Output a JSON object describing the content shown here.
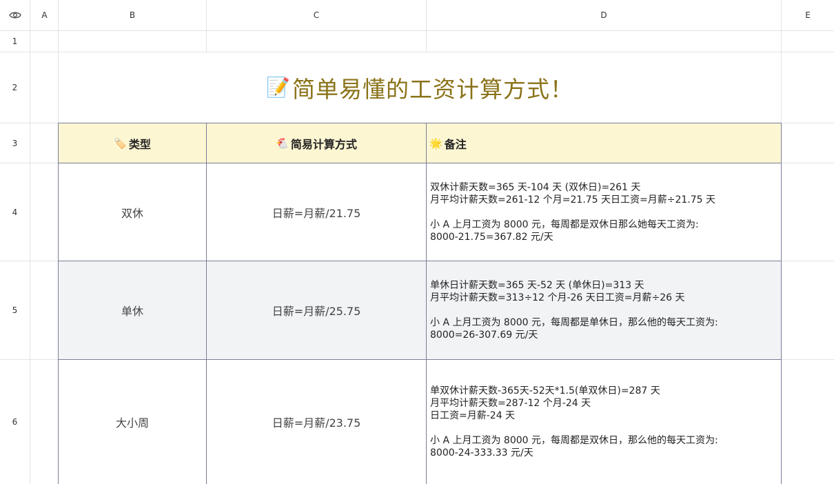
{
  "columns": [
    "A",
    "B",
    "C",
    "D",
    "E"
  ],
  "rows": [
    "1",
    "2",
    "3",
    "4",
    "5",
    "6"
  ],
  "corner_icon": "eye-icon",
  "title": {
    "emoji": "📝",
    "text": "简单易懂的工资计算方式！"
  },
  "table": {
    "headers": [
      {
        "icon": "🏷️",
        "icon_name": "label-tag-icon",
        "label": "类型"
      },
      {
        "icon": "🐔",
        "icon_name": "chicken-icon",
        "label": "简易计算方式"
      },
      {
        "icon": "🌟",
        "icon_name": "glowing-star-icon",
        "label": "备注"
      }
    ],
    "rows": [
      {
        "type": "双休",
        "formula": "日薪=月薪/21.75",
        "note": {
          "l1": "双休计薪天数=365 天-104 天 (双休日)=261 天",
          "l2": "月平均计薪天数=261-12 个月=21.75 天日工资=月薪÷21.75 天",
          "l3": "小 A 上月工资为 8000 元，每周都是双休日那么她每天工资为:",
          "l4": "8000-21.75=367.82 元/天"
        }
      },
      {
        "type": "单休",
        "formula": "日薪=月薪/25.75",
        "note": {
          "l1": "单休日计薪天数=365 天-52 天 (单休日)=313 天",
          "l2": "月平均计薪天数=313÷12 个月-26 天日工资=月薪÷26 天",
          "l3": "小 A 上月工资为 8000 元，每周都是单休日，那么他的每天工资为:",
          "l4": "8000=26-307.69 元/天"
        }
      },
      {
        "type": "大小周",
        "formula": "日薪=月薪/23.75",
        "note": {
          "l1": "单双休计薪天数-365天-52天*1.5(单双休日)=287 天",
          "l2": "月平均计薪天数=287-12 个月-24 天",
          "l2b": "日工资=月薪-24 天",
          "l3": "小 A 上月工资为 8000 元，每周都是双休日，那么他的每天工资为:",
          "l4": "8000-24-333.33 元/天"
        }
      }
    ]
  }
}
